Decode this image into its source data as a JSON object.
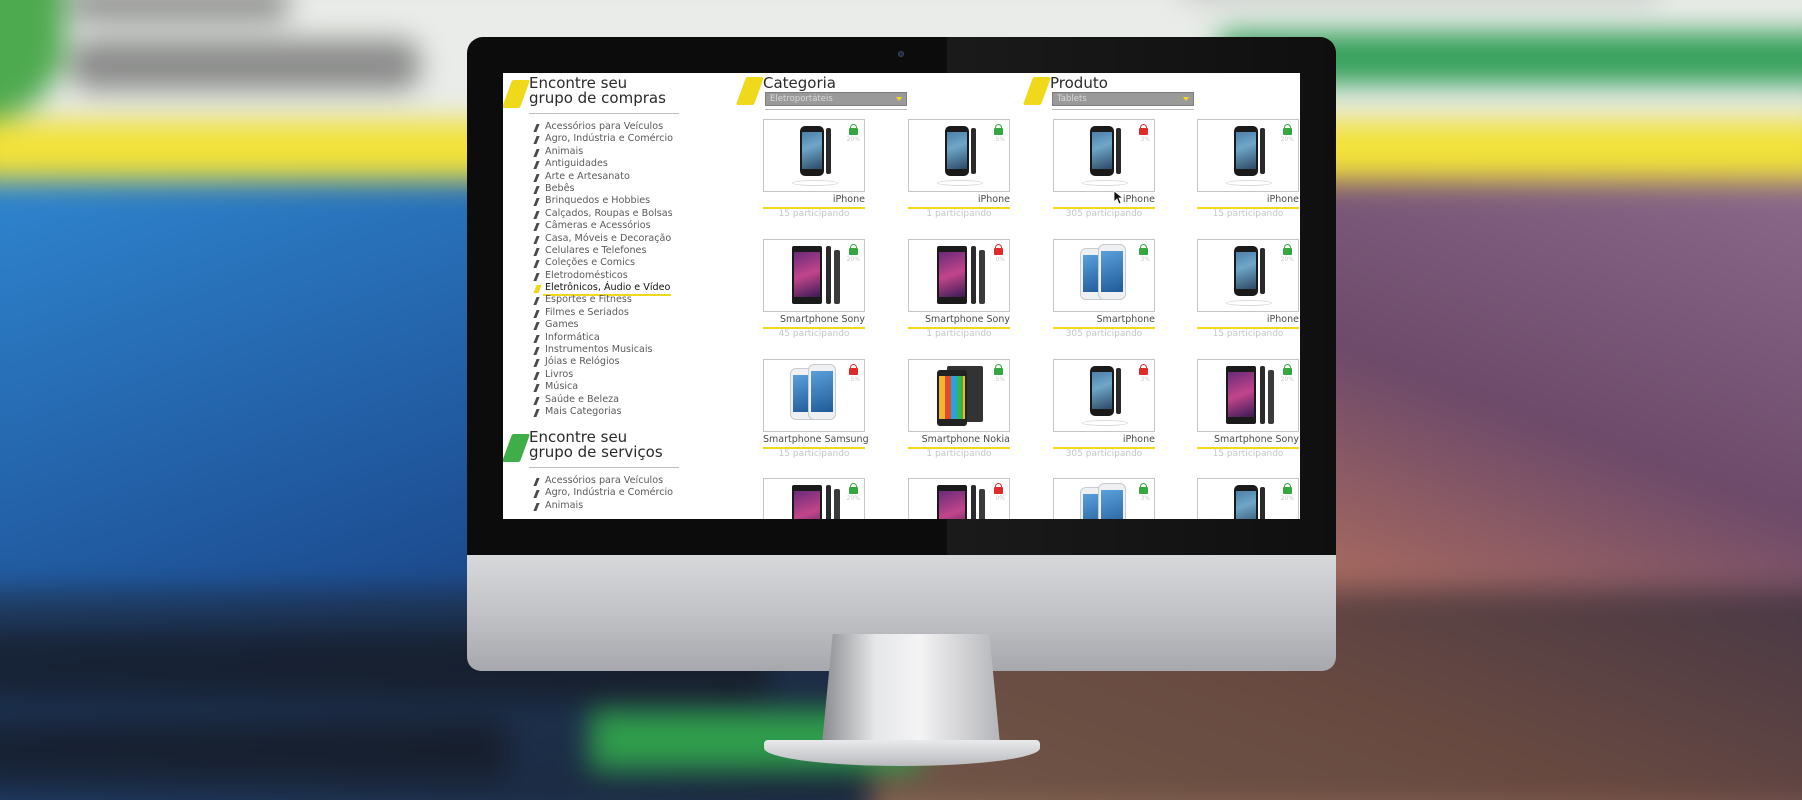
{
  "sidebar": {
    "shopping": {
      "title_line1": "Encontre seu",
      "title_line2": "grupo de compras",
      "items": [
        "Acessórios para Veículos",
        "Agro, Indústria e Comércio",
        "Animais",
        "Antiguidades",
        "Arte e Artesanato",
        "Bebês",
        "Brinquedos e Hobbies",
        "Calçados, Roupas e Bolsas",
        "Câmeras e Acessórios",
        "Casa, Móveis e Decoração",
        "Celulares e Telefones",
        "Coleções e Comics",
        "Eletrodomésticos",
        "Eletrônicos, Áudio e Vídeo",
        "Esportes e Fitness",
        "Filmes e Seriados",
        "Games",
        "Informática",
        "Instrumentos Musicais",
        "Jóias e Relógios",
        "Livros",
        "Música",
        "Saúde e Beleza",
        "Mais Categorias"
      ],
      "active_index": 13
    },
    "services": {
      "title_line1": "Encontre seu",
      "title_line2": "grupo de serviços",
      "items": [
        "Acessórios para Veículos",
        "Agro, Indústria e Comércio",
        "Animais"
      ]
    }
  },
  "filters": {
    "category": {
      "title": "Categoria",
      "selected": "Eletroportáteis"
    },
    "product": {
      "title": "Produto",
      "selected": "Tablets"
    }
  },
  "products": [
    {
      "name": "iPhone",
      "participants": "15 participando",
      "locked": false,
      "pct": "20%",
      "kind": "iphone"
    },
    {
      "name": "iPhone",
      "participants": "1 participando",
      "locked": false,
      "pct": "5%",
      "kind": "iphone"
    },
    {
      "name": "iPhone",
      "participants": "305 participando",
      "locked": true,
      "pct": "3%",
      "kind": "iphone"
    },
    {
      "name": "iPhone",
      "participants": "15 participando",
      "locked": false,
      "pct": "20%",
      "kind": "iphone"
    },
    {
      "name": "Smartphone Sony",
      "participants": "45 participando",
      "locked": false,
      "pct": "20%",
      "kind": "sony"
    },
    {
      "name": "Smartphone Sony",
      "participants": "1 participando",
      "locked": true,
      "pct": "0%",
      "kind": "sony"
    },
    {
      "name": "Smartphone",
      "participants": "305 participando",
      "locked": false,
      "pct": "3%",
      "kind": "samsung"
    },
    {
      "name": "iPhone",
      "participants": "15 participando",
      "locked": false,
      "pct": "20%",
      "kind": "iphone-single"
    },
    {
      "name": "Smartphone Samsung",
      "participants": "15 participando",
      "locked": true,
      "pct": "5%",
      "kind": "samsung"
    },
    {
      "name": "Smartphone Nokia",
      "participants": "1 participando",
      "locked": false,
      "pct": "5%",
      "kind": "nokia"
    },
    {
      "name": "iPhone",
      "participants": "305 participando",
      "locked": true,
      "pct": "3%",
      "kind": "iphone"
    },
    {
      "name": "Smartphone Sony",
      "participants": "15 participando",
      "locked": false,
      "pct": "20%",
      "kind": "sony"
    },
    {
      "name": "",
      "participants": "",
      "locked": false,
      "pct": "20%",
      "kind": "sony"
    },
    {
      "name": "",
      "participants": "",
      "locked": true,
      "pct": "0%",
      "kind": "sony"
    },
    {
      "name": "",
      "participants": "",
      "locked": false,
      "pct": "3%",
      "kind": "samsung"
    },
    {
      "name": "",
      "participants": "",
      "locked": false,
      "pct": "20%",
      "kind": "iphone-single"
    }
  ],
  "colors": {
    "accent_yellow": "#f0d91a",
    "accent_green": "#3fae48",
    "lock_open": "#33a83f",
    "lock_closed": "#e02a2a"
  }
}
